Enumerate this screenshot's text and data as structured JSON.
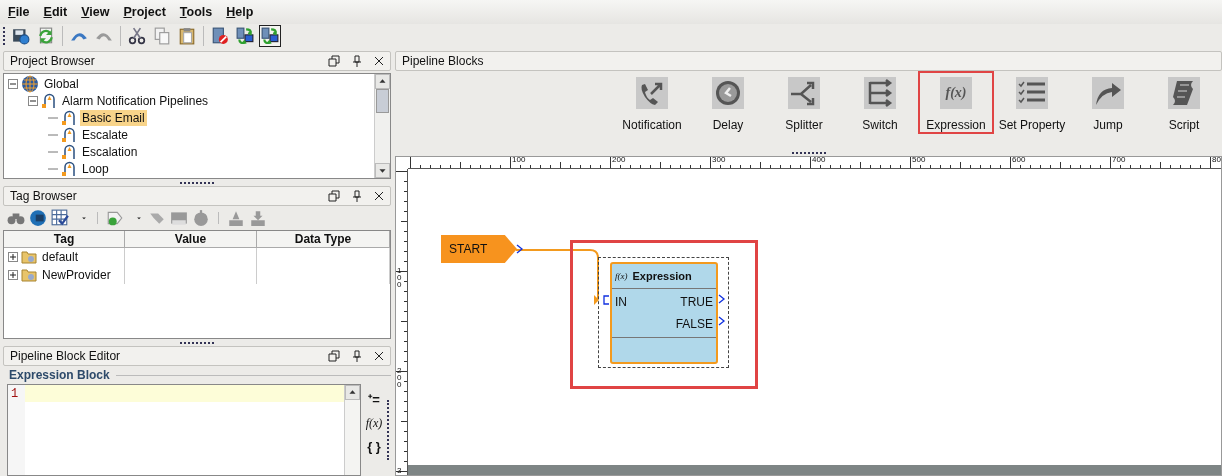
{
  "menu": [
    "File",
    "Edit",
    "View",
    "Project",
    "Tools",
    "Help"
  ],
  "toolbar": [
    {
      "kind": "save",
      "pressed": false
    },
    {
      "kind": "reload",
      "pressed": false
    },
    {
      "kind": "undo",
      "pressed": false
    },
    {
      "kind": "redo",
      "pressed": false
    },
    {
      "kind": "cut",
      "pressed": false
    },
    {
      "kind": "copy",
      "pressed": false
    },
    {
      "kind": "paste",
      "pressed": false
    },
    {
      "kind": "db-stop",
      "pressed": false
    },
    {
      "kind": "pc-sync",
      "pressed": false
    },
    {
      "kind": "pc-sync",
      "pressed": true
    }
  ],
  "project_browser": {
    "title": "Project Browser",
    "tree": [
      {
        "label": "Global",
        "kind": "globe",
        "expanded": true,
        "selected": false,
        "children": [
          {
            "label": "Alarm Notification Pipelines",
            "kind": "pipelines",
            "expanded": true,
            "selected": false,
            "children": [
              {
                "label": "Basic Email",
                "kind": "pipeline",
                "selected": true
              },
              {
                "label": "Escalate",
                "kind": "pipeline",
                "selected": false
              },
              {
                "label": "Escalation",
                "kind": "pipeline",
                "selected": false
              },
              {
                "label": "Loop",
                "kind": "pipeline",
                "selected": false
              }
            ]
          }
        ]
      }
    ]
  },
  "tag_browser": {
    "title": "Tag Browser",
    "columns": [
      "Tag",
      "Value",
      "Data Type"
    ],
    "rows": [
      {
        "tag": "default",
        "expanded": false
      },
      {
        "tag": "NewProvider",
        "expanded": false
      }
    ]
  },
  "block_editor": {
    "title": "Pipeline Block Editor",
    "section": "Expression Block",
    "line_numbers": [
      "1"
    ],
    "tools": [
      "⁺=",
      "f(x)",
      "{ }"
    ]
  },
  "pipeline_blocks": {
    "title": "Pipeline Blocks",
    "items": [
      {
        "label": "Notification",
        "kind": "notification",
        "highlighted": false
      },
      {
        "label": "Delay",
        "kind": "delay",
        "highlighted": false
      },
      {
        "label": "Splitter",
        "kind": "splitter",
        "highlighted": false
      },
      {
        "label": "Switch",
        "kind": "switch",
        "highlighted": false
      },
      {
        "label": "Expression",
        "kind": "expression",
        "icon_text": "f(x)",
        "highlighted": true
      },
      {
        "label": "Set Property",
        "kind": "set-property",
        "highlighted": false
      },
      {
        "label": "Jump",
        "kind": "jump",
        "highlighted": false
      },
      {
        "label": "Script",
        "kind": "script",
        "highlighted": false
      }
    ]
  },
  "canvas": {
    "top_ruler": [
      "100",
      "200",
      "300",
      "400",
      "500",
      "600",
      "700",
      "80"
    ],
    "left_ruler": [
      "100",
      "200",
      "3"
    ],
    "start": {
      "label": "START"
    },
    "node": {
      "icon_text": "f(x)",
      "title": "Expression",
      "input": "IN",
      "outputs": [
        "TRUE",
        "FALSE"
      ],
      "selected": true,
      "highlighted": true
    }
  }
}
